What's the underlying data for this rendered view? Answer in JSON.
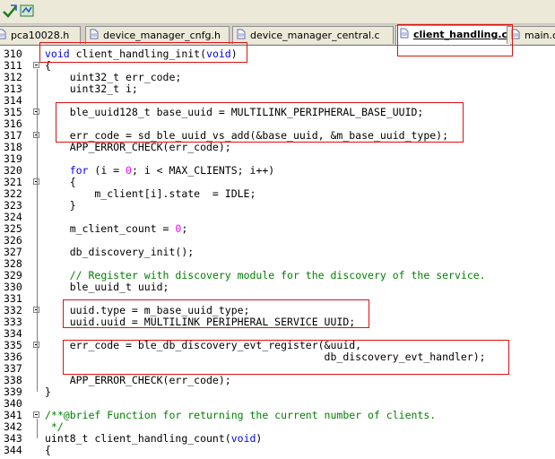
{
  "toolbar": {
    "icons": [
      "arrow-icon",
      "refresh-icon"
    ]
  },
  "tabs": [
    {
      "label": "pca10028.h",
      "active": false
    },
    {
      "label": "device_manager_cnfg.h",
      "active": false
    },
    {
      "label": "device_manager_central.c",
      "active": false
    },
    {
      "label": "client_handling.c",
      "active": true
    },
    {
      "label": "main.c",
      "active": false
    }
  ],
  "editor": {
    "lines": [
      {
        "n": "310",
        "t": "void client_handling_init(void)"
      },
      {
        "n": "311",
        "t": "{"
      },
      {
        "n": "312",
        "t": "    uint32_t err_code;"
      },
      {
        "n": "313",
        "t": "    uint32_t i;"
      },
      {
        "n": "314",
        "t": ""
      },
      {
        "n": "315",
        "t": "    ble_uuid128_t base_uuid = MULTILINK_PERIPHERAL_BASE_UUID;"
      },
      {
        "n": "316",
        "t": ""
      },
      {
        "n": "317",
        "t": "    err_code = sd_ble_uuid_vs_add(&base_uuid, &m_base_uuid_type);"
      },
      {
        "n": "318",
        "t": "    APP_ERROR_CHECK(err_code);"
      },
      {
        "n": "319",
        "t": ""
      },
      {
        "n": "320",
        "t": "    for (i = 0; i < MAX_CLIENTS; i++)"
      },
      {
        "n": "321",
        "t": "    {"
      },
      {
        "n": "322",
        "t": "        m_client[i].state  = IDLE;"
      },
      {
        "n": "323",
        "t": "    }"
      },
      {
        "n": "324",
        "t": ""
      },
      {
        "n": "325",
        "t": "    m_client_count = 0;"
      },
      {
        "n": "326",
        "t": ""
      },
      {
        "n": "327",
        "t": "    db_discovery_init();"
      },
      {
        "n": "328",
        "t": ""
      },
      {
        "n": "329",
        "t": "    // Register with discovery module for the discovery of the service."
      },
      {
        "n": "330",
        "t": "    ble_uuid_t uuid;"
      },
      {
        "n": "331",
        "t": ""
      },
      {
        "n": "332",
        "t": "    uuid.type = m_base_uuid_type;"
      },
      {
        "n": "333",
        "t": "    uuid.uuid = MULTILINK_PERIPHERAL_SERVICE_UUID;"
      },
      {
        "n": "334",
        "t": ""
      },
      {
        "n": "335",
        "t": "    err_code = ble_db_discovery_evt_register(&uuid,"
      },
      {
        "n": "336",
        "t": "                                             db_discovery_evt_handler);"
      },
      {
        "n": "337",
        "t": ""
      },
      {
        "n": "338",
        "t": "    APP_ERROR_CHECK(err_code);"
      },
      {
        "n": "339",
        "t": "}"
      },
      {
        "n": "340",
        "t": ""
      },
      {
        "n": "341",
        "t": "/**@brief Function for returning the current number of clients."
      },
      {
        "n": "342",
        "t": " */"
      },
      {
        "n": "343",
        "t": "uint8_t client_handling_count(void)"
      },
      {
        "n": "344",
        "t": "{"
      }
    ]
  },
  "colors": {
    "keyword": "#0000ff",
    "number": "#ff00ff",
    "comment": "#008000",
    "highlight_box": "#e01010",
    "tab_bg": "#ece9d8",
    "active_tab_bg": "#ffffff"
  }
}
